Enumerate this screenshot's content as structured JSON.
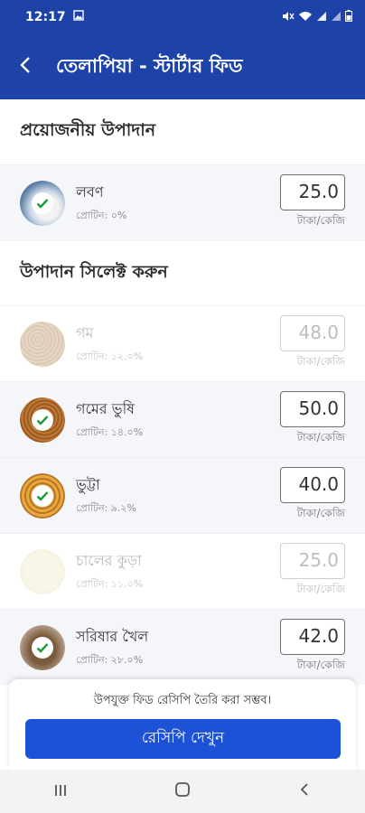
{
  "status_bar": {
    "time": "12:17",
    "image_icon": "image-icon",
    "right_icons": [
      "mute-icon",
      "wifi-icon",
      "signal-icon",
      "signal-icon",
      "battery-icon"
    ]
  },
  "app_bar": {
    "title": "তেলাপিয়া - স্টার্টার ফিড",
    "back_icon": "chevron-left-icon",
    "bg_color": "#1d43a8"
  },
  "sections": {
    "required_title": "প্রয়োজনীয় উপাদান",
    "select_title": "উপাদান সিলেক্ট করুন"
  },
  "required_items": [
    {
      "name": "লবণ",
      "protein": "প্রোটিন: ০%",
      "price": "25.0",
      "unit": "টাকা/কেজি",
      "selected": true
    }
  ],
  "select_items": [
    {
      "name": "গম",
      "protein": "প্রোটিন: ১২.০%",
      "price": "48.0",
      "unit": "টাকা/কেজি",
      "selected": false
    },
    {
      "name": "গমের ভুষি",
      "protein": "প্রোটিন: ১৪.০%",
      "price": "50.0",
      "unit": "টাকা/কেজি",
      "selected": true
    },
    {
      "name": "ভুট্টা",
      "protein": "প্রোটিন: ৯.২%",
      "price": "40.0",
      "unit": "টাকা/কেজি",
      "selected": true
    },
    {
      "name": "চালের কুড়া",
      "protein": "প্রোটিন: ১১.০%",
      "price": "25.0",
      "unit": "টাকা/কেজি",
      "selected": false
    },
    {
      "name": "সরিষার খৈল",
      "protein": "প্রোটিন: ২৮.০%",
      "price": "42.0",
      "unit": "টাকা/কেজি",
      "selected": true
    }
  ],
  "bottom": {
    "hint": "উপযুক্ত ফিড রেসিপি তৈরি করা সম্ভব।",
    "button_label": "রেসিপি দেখুন",
    "button_color": "#1d52d6"
  },
  "nav": {
    "recent_icon": "recents-icon",
    "home_icon": "home-icon",
    "back_icon": "back-icon"
  }
}
